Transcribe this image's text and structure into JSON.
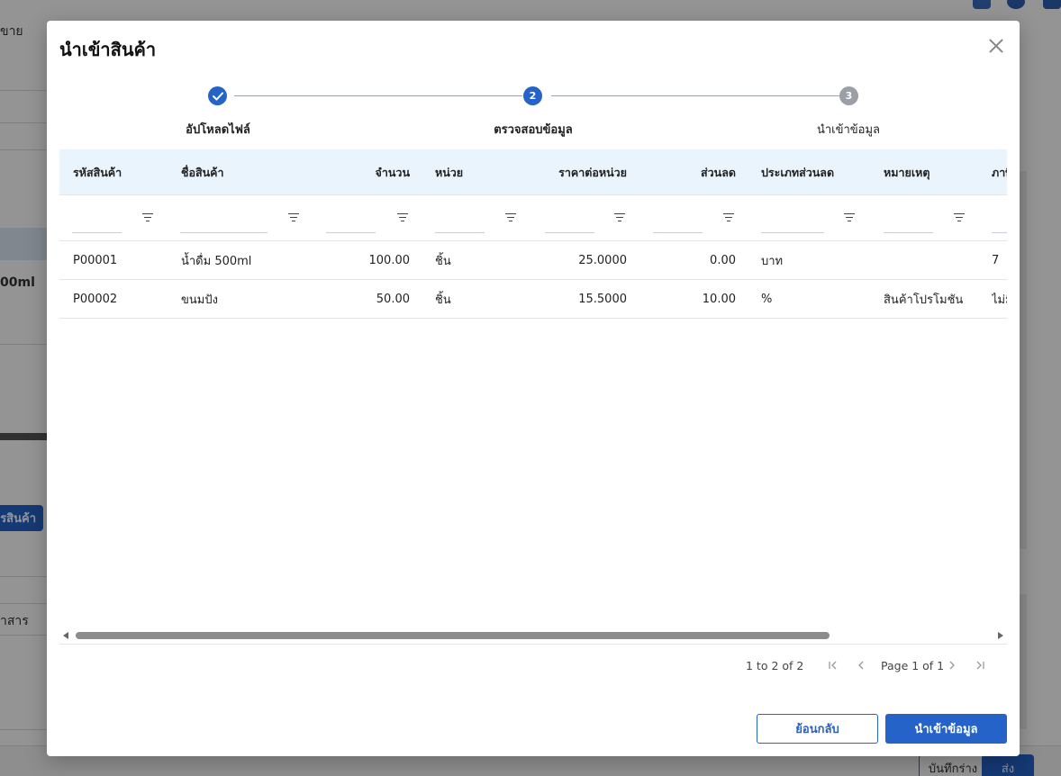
{
  "background": {
    "top_left_text": "ขาย",
    "product_snippet": "00ml",
    "add_product_button": "รสินค้า",
    "document_text": "าสาร",
    "save_draft_button": "บันทึกร่าง",
    "send_button": "ส่ง"
  },
  "modal": {
    "title": "นำเข้าสินค้า",
    "stepper": {
      "steps": [
        {
          "number": "1",
          "label": "อัปโหลดไฟล์",
          "status": "done"
        },
        {
          "number": "2",
          "label": "ตรวจสอบข้อมูล",
          "status": "active"
        },
        {
          "number": "3",
          "label": "นำเข้าข้อมูล",
          "status": "pending"
        }
      ]
    },
    "grid": {
      "columns": [
        {
          "key": "code",
          "label": "รหัสสินค้า"
        },
        {
          "key": "name",
          "label": "ชื่อสินค้า"
        },
        {
          "key": "qty",
          "label": "จำนวน"
        },
        {
          "key": "unit",
          "label": "หน่วย"
        },
        {
          "key": "price",
          "label": "ราคาต่อหน่วย"
        },
        {
          "key": "discount",
          "label": "ส่วนลด"
        },
        {
          "key": "discount_type",
          "label": "ประเภทส่วนลด"
        },
        {
          "key": "note",
          "label": "หมายเหตุ"
        },
        {
          "key": "tax",
          "label": "ภาษี"
        }
      ],
      "rows": [
        {
          "code": "P00001",
          "name": "น้ำดื่ม 500ml",
          "qty": "100.00",
          "unit": "ชิ้น",
          "price": "25.0000",
          "discount": "0.00",
          "discount_type": "บาท",
          "note": "",
          "tax": "7"
        },
        {
          "code": "P00002",
          "name": "ขนมปัง",
          "qty": "50.00",
          "unit": "ชิ้น",
          "price": "15.5000",
          "discount": "10.00",
          "discount_type": "%",
          "note": "สินค้าโปรโมชัน",
          "tax": "ไม่มี"
        }
      ]
    },
    "pagination": {
      "count_text": "1 to 2 of 2",
      "page_text": "Page 1 of 1",
      "first_icon": "first-page-icon",
      "prev_icon": "chevron-left-icon",
      "next_icon": "chevron-right-icon",
      "last_icon": "last-page-icon"
    },
    "buttons": {
      "back_label": "ย้อนกลับ",
      "import_label": "นำเข้าข้อมูล"
    },
    "accent_color": "#2563c8"
  }
}
